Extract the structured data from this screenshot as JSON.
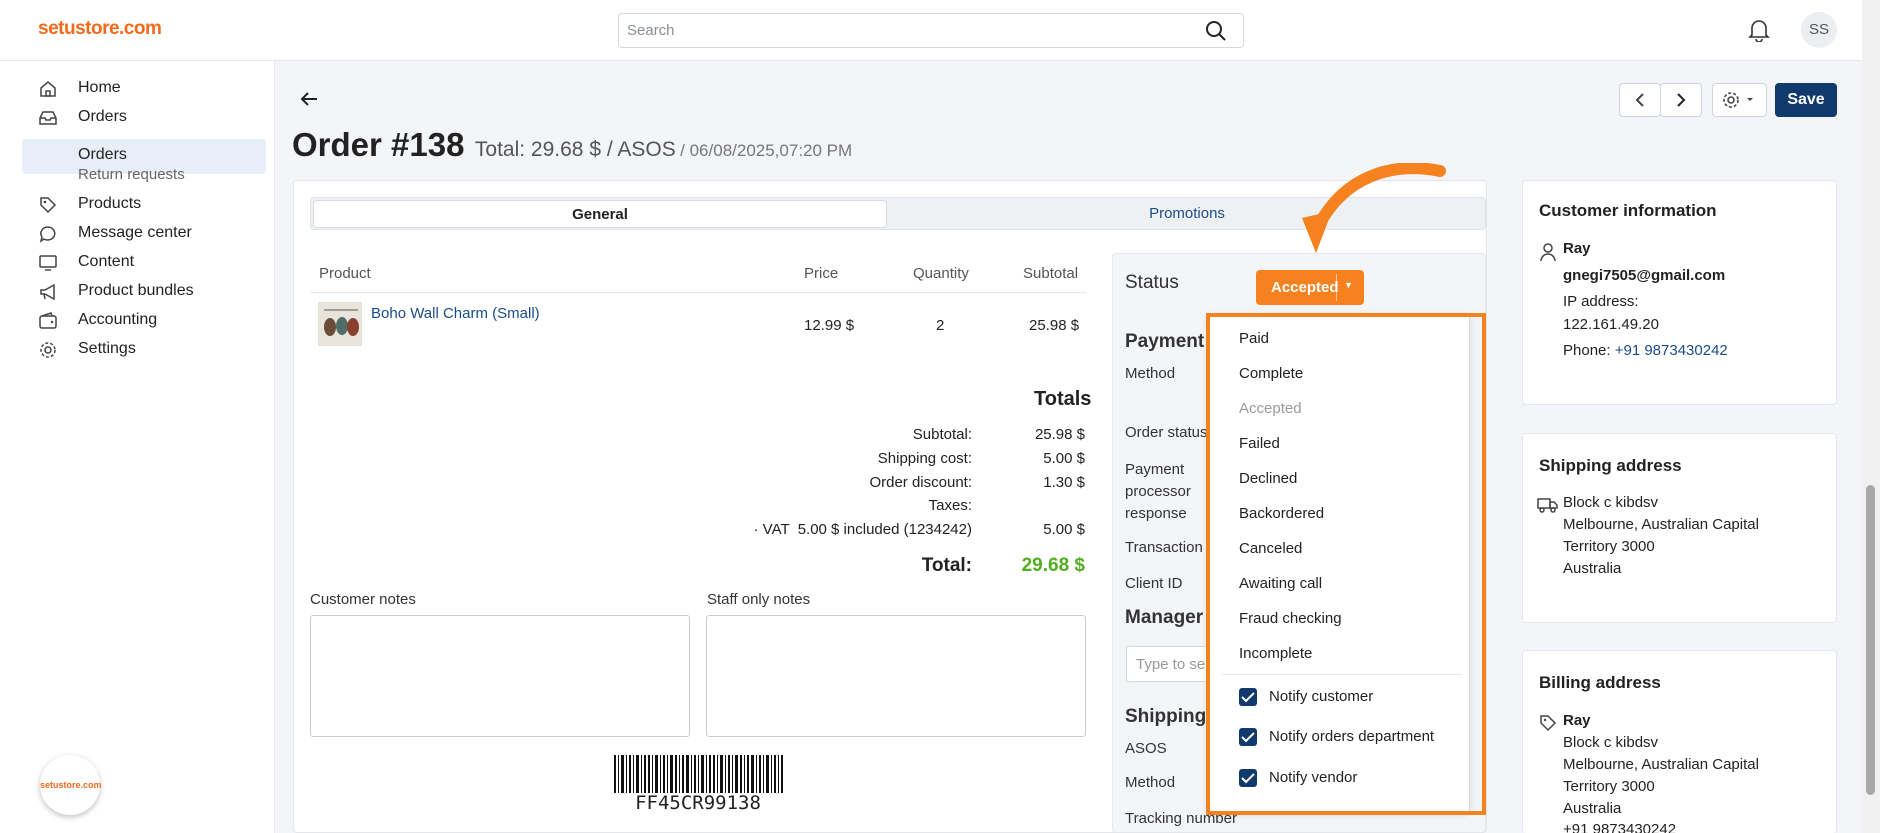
{
  "brand": {
    "logo": "setustore.com",
    "mini_logo": "setustore.com"
  },
  "search": {
    "placeholder": "Search"
  },
  "user": {
    "initials": "SS"
  },
  "sidebar": {
    "items": [
      {
        "label": "Home",
        "icon": "home-icon"
      },
      {
        "label": "Orders",
        "icon": "inbox-icon"
      },
      {
        "label": "Orders",
        "icon": ""
      },
      {
        "label": "Return requests",
        "icon": ""
      },
      {
        "label": "Products",
        "icon": "tag-icon"
      },
      {
        "label": "Message center",
        "icon": "chat-icon"
      },
      {
        "label": "Content",
        "icon": "monitor-icon"
      },
      {
        "label": "Product bundles",
        "icon": "megaphone-icon"
      },
      {
        "label": "Accounting",
        "icon": "wallet-icon"
      },
      {
        "label": "Settings",
        "icon": "gear-icon"
      }
    ]
  },
  "header": {
    "order_title": "Order #138",
    "summary": "Total: 29.68 $ / ASOS",
    "date": "/ 06/08/2025,07:20 PM",
    "save_label": "Save"
  },
  "tabs": [
    {
      "label": "General"
    },
    {
      "label": "Promotions"
    }
  ],
  "items_table": {
    "headers": [
      "Product",
      "Price",
      "Quantity",
      "Subtotal"
    ],
    "rows": [
      {
        "product": "Boho Wall Charm (Small)",
        "price": "12.99 $",
        "quantity": "2",
        "subtotal": "25.98 $"
      }
    ]
  },
  "totals": {
    "heading": "Totals",
    "lines": [
      {
        "label": "Subtotal:",
        "value": "25.98 $"
      },
      {
        "label": "Shipping cost:",
        "value": "5.00 $"
      },
      {
        "label": "Order discount:",
        "value": "1.30 $"
      },
      {
        "label": "Taxes:",
        "value": ""
      },
      {
        "label": "· VAT  5.00 $ included (1234242)",
        "value": "5.00 $"
      }
    ],
    "total_label": "Total:",
    "total_value": "29.68 $",
    "total_color": "#52b01f"
  },
  "notes": {
    "customer_label": "Customer notes",
    "staff_label": "Staff only notes"
  },
  "barcode": {
    "code": "FF45CR99138"
  },
  "status_panel": {
    "status_label": "Status",
    "status_value": "Accepted",
    "payment_heading": "Payment",
    "method_label": "Method",
    "order_status_label": "Order status",
    "processor_response_label": "Payment processor response",
    "transaction_label": "Transaction",
    "client_id_label": "Client ID",
    "manager_heading": "Manager",
    "manager_placeholder": "Type to se",
    "shipping_heading": "Shipping",
    "shipping_vendor": "ASOS",
    "shipping_method_label": "Method",
    "tracking_label": "Tracking number"
  },
  "status_dropdown": {
    "options": [
      "Paid",
      "Complete",
      "Accepted",
      "Failed",
      "Declined",
      "Backordered",
      "Canceled",
      "Awaiting call",
      "Fraud checking",
      "Incomplete"
    ],
    "checkboxes": [
      "Notify customer",
      "Notify orders department",
      "Notify vendor"
    ],
    "accent": "#f5821f"
  },
  "customer": {
    "heading": "Customer information",
    "name": "Ray",
    "email": "gnegi7505@gmail.com",
    "ip_label": "IP address:",
    "ip": "122.161.49.20",
    "phone_label": "Phone:",
    "phone": "+91 9873430242"
  },
  "shipping_address": {
    "heading": "Shipping address",
    "lines": [
      "Block c kibdsv",
      "Melbourne, Australian Capital",
      "Territory 3000",
      "Australia"
    ]
  },
  "billing_address": {
    "heading": "Billing address",
    "name": "Ray",
    "lines": [
      "Block c kibdsv",
      "Melbourne, Australian Capital",
      "Territory 3000",
      "Australia"
    ],
    "phone": "+91 9873430242"
  },
  "colors": {
    "brand": "#f26a1b",
    "primary": "#103a6b",
    "link": "#1b4c87"
  }
}
